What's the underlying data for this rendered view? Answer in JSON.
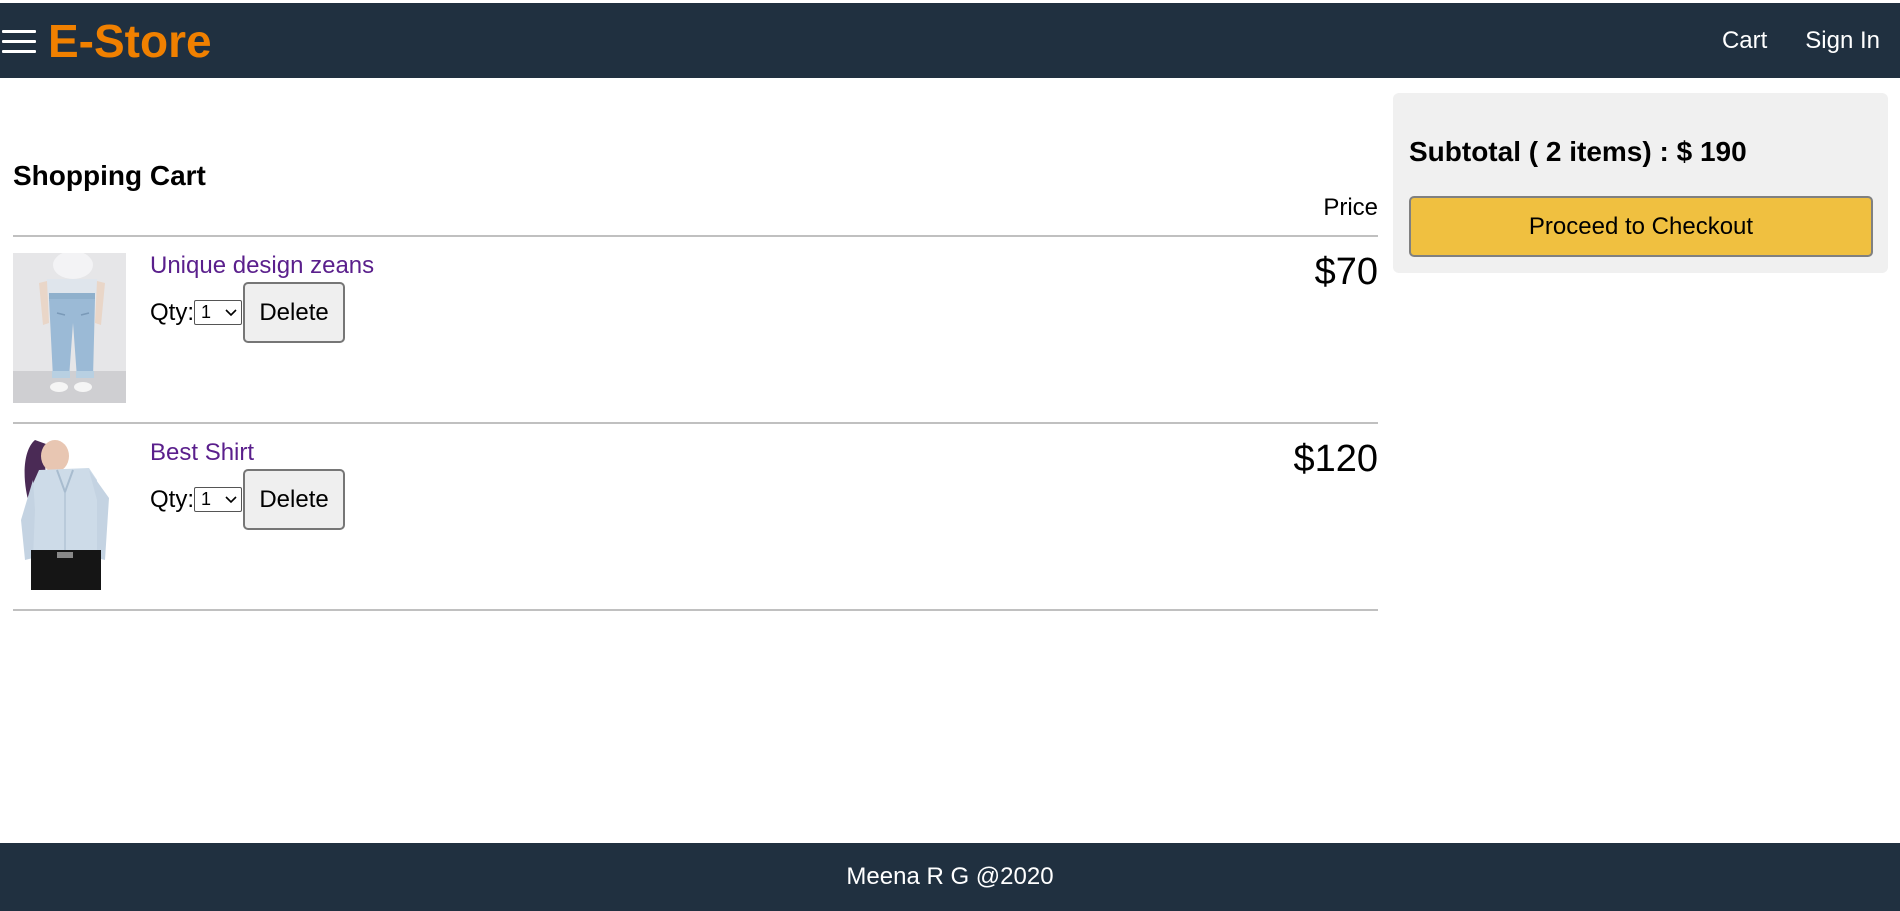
{
  "header": {
    "brand": "E-Store",
    "nav": {
      "cart": "Cart",
      "signin": "Sign In"
    }
  },
  "cart": {
    "title": "Shopping Cart",
    "price_header": "Price",
    "qty_label": "Qty:",
    "delete_label": "Delete",
    "items": [
      {
        "name": "Unique design zeans",
        "qty": "1",
        "price": "$70",
        "image": "jeans-photo"
      },
      {
        "name": "Best Shirt",
        "qty": "1",
        "price": "$120",
        "image": "shirt-photo"
      }
    ]
  },
  "summary": {
    "subtotal_prefix": "Subtotal ( 2 items) : $ ",
    "subtotal_amount": "190",
    "checkout_label": "Proceed to Checkout"
  },
  "footer": {
    "text": "Meena R G @2020"
  },
  "colors": {
    "header_bg": "#203040",
    "brand": "#f08000",
    "link": "#5a1f8c",
    "checkout_bg": "#f0c040",
    "summary_bg": "#f0f0f0"
  }
}
